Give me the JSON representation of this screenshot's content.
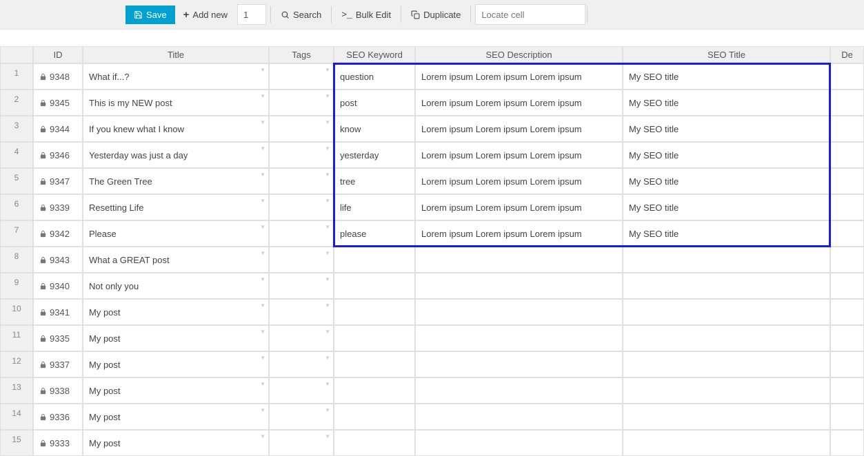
{
  "toolbar": {
    "save_label": "Save",
    "add_new_label": "Add new",
    "qty_value": "1",
    "search_label": "Search",
    "bulk_edit_label": "Bulk Edit",
    "duplicate_label": "Duplicate",
    "locate_placeholder": "Locate cell"
  },
  "columns": [
    "ID",
    "Title",
    "Tags",
    "SEO Keyword",
    "SEO Description",
    "SEO Title",
    "De"
  ],
  "rows": [
    {
      "n": "1",
      "id": "9348",
      "title": "What if...?",
      "tags": "",
      "kw": "question",
      "desc": "Lorem ipsum Lorem ipsum Lorem ipsum",
      "stitle": "My SEO title"
    },
    {
      "n": "2",
      "id": "9345",
      "title": "This is my NEW post",
      "tags": "",
      "kw": "post",
      "desc": "Lorem ipsum Lorem ipsum Lorem ipsum",
      "stitle": "My SEO title"
    },
    {
      "n": "3",
      "id": "9344",
      "title": "If you knew what I know",
      "tags": "",
      "kw": "know",
      "desc": "Lorem ipsum Lorem ipsum Lorem ipsum",
      "stitle": "My SEO title"
    },
    {
      "n": "4",
      "id": "9346",
      "title": "Yesterday was just a day",
      "tags": "",
      "kw": "yesterday",
      "desc": "Lorem ipsum Lorem ipsum Lorem ipsum",
      "stitle": "My SEO title"
    },
    {
      "n": "5",
      "id": "9347",
      "title": "The Green Tree",
      "tags": "",
      "kw": "tree",
      "desc": "Lorem ipsum Lorem ipsum Lorem ipsum",
      "stitle": "My SEO title"
    },
    {
      "n": "6",
      "id": "9339",
      "title": "Resetting Life",
      "tags": "",
      "kw": "life",
      "desc": "Lorem ipsum Lorem ipsum Lorem ipsum",
      "stitle": "My SEO title"
    },
    {
      "n": "7",
      "id": "9342",
      "title": "Please",
      "tags": "",
      "kw": "please",
      "desc": "Lorem ipsum Lorem ipsum Lorem ipsum",
      "stitle": "My SEO title"
    },
    {
      "n": "8",
      "id": "9343",
      "title": "What a GREAT post",
      "tags": "",
      "kw": "",
      "desc": "",
      "stitle": ""
    },
    {
      "n": "9",
      "id": "9340",
      "title": "Not only you",
      "tags": "",
      "kw": "",
      "desc": "",
      "stitle": ""
    },
    {
      "n": "10",
      "id": "9341",
      "title": "My post",
      "tags": "",
      "kw": "",
      "desc": "",
      "stitle": ""
    },
    {
      "n": "11",
      "id": "9335",
      "title": "My post",
      "tags": "",
      "kw": "",
      "desc": "",
      "stitle": ""
    },
    {
      "n": "12",
      "id": "9337",
      "title": "My post",
      "tags": "",
      "kw": "",
      "desc": "",
      "stitle": ""
    },
    {
      "n": "13",
      "id": "9338",
      "title": "My post",
      "tags": "",
      "kw": "",
      "desc": "",
      "stitle": ""
    },
    {
      "n": "14",
      "id": "9336",
      "title": "My post",
      "tags": "",
      "kw": "",
      "desc": "",
      "stitle": ""
    },
    {
      "n": "15",
      "id": "9333",
      "title": "My post",
      "tags": "",
      "kw": "",
      "desc": "",
      "stitle": ""
    }
  ],
  "highlight": {
    "start_row_idx": 0,
    "end_row_idx": 6,
    "start_col_idx": 3,
    "end_col_idx": 5
  }
}
